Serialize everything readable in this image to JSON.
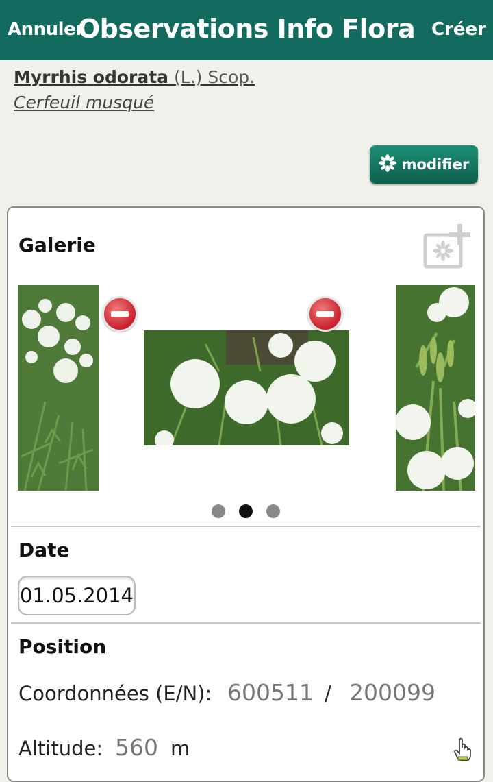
{
  "header": {
    "cancel_label": "Annuler",
    "title": "Observations Info Flora",
    "create_label": "Créer",
    "bg_color": "#136b60"
  },
  "species": {
    "scientific_name": "Myrrhis odorata",
    "author": "(L.) Scop.",
    "common_name": "Cerfeuil musqué"
  },
  "modify_button": {
    "label": "modifier",
    "icon": "flower-icon"
  },
  "gallery": {
    "title": "Galerie",
    "add_icon": "add-photo-icon",
    "photo_count": 3,
    "active_index": 1
  },
  "date": {
    "title": "Date",
    "value": "01.05.2014"
  },
  "position": {
    "title": "Position",
    "coords_label": "Coordonnées (E/N):",
    "east": "600511",
    "separator": "/",
    "north": "200099",
    "altitude_label": "Altitude:",
    "altitude_value": "560",
    "altitude_unit": "m",
    "edit_icon": "hand-pointer-icon"
  }
}
